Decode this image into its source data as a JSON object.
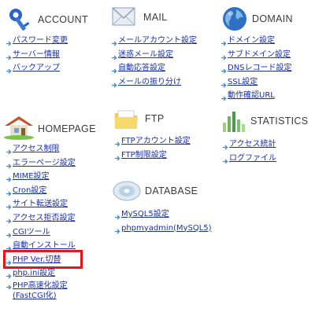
{
  "account": {
    "title": "ACCOUNT",
    "icon": "account-key-icon",
    "links": [
      "パスワード変更",
      "サーバー情報",
      "バックアップ"
    ]
  },
  "mail": {
    "title": "MAIL",
    "icon": "mail-envelope-icon",
    "links": [
      "メールアカウント設定",
      "迷惑メール設定",
      "自動応答設定",
      "メールの振り分け"
    ]
  },
  "domain": {
    "title": "DOMAIN",
    "icon": "globe-icon",
    "links": [
      "ドメイン設定",
      "サブドメイン設定",
      "DNSレコード設定",
      "SSL設定",
      "動作確認URL"
    ]
  },
  "homepage": {
    "title": "HOMEPAGE",
    "icon": "house-icon",
    "links": [
      "アクセス制限",
      "エラーページ設定",
      "MIME設定",
      "Cron設定",
      "サイト転送設定",
      "アクセス拒否設定",
      "CGIツール",
      "自動インストール",
      "PHP Ver.切替",
      "php.ini設定",
      "PHP高速化設定",
      "(FastCGI化)"
    ]
  },
  "ftp": {
    "title": "FTP",
    "icon": "folder-icon",
    "links": [
      "FTPアカウント設定",
      "FTP制限設定"
    ]
  },
  "statistics": {
    "title": "STATISTICS",
    "icon": "bar-chart-icon",
    "links": [
      "アクセス統計",
      "ログファイル"
    ]
  },
  "database": {
    "title": "DATABASE",
    "icon": "database-disc-icon",
    "links": [
      "MySQL5設定",
      "phpmyadmin(MySQL5)"
    ]
  },
  "colors": {
    "link": "#1a2fa8",
    "highlight": "#e8141a",
    "arrow": "#3b8cd6"
  }
}
